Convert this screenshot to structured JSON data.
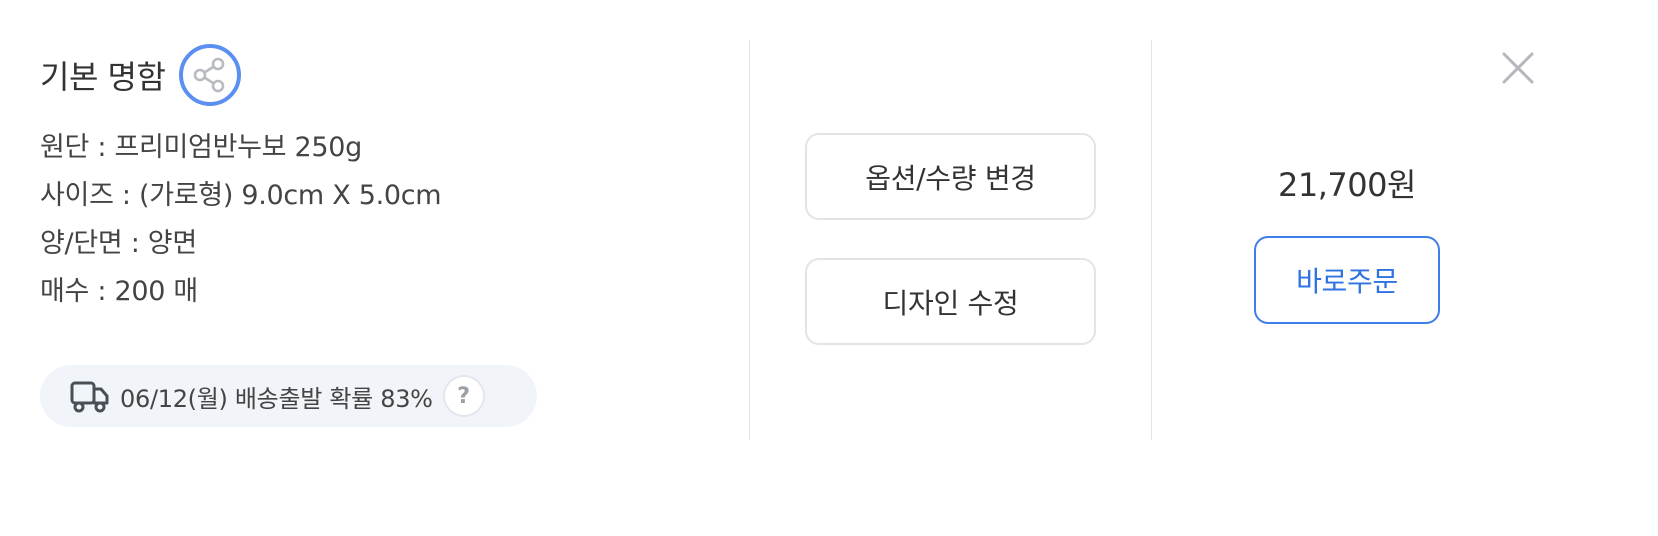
{
  "product": {
    "title": "기본 명함",
    "specs": [
      "원단 : 프리미엄반누보 250g",
      "사이즈 : (가로형) 9.0cm X 5.0cm",
      "양/단면 : 양면",
      "매수 : 200 매"
    ]
  },
  "delivery": {
    "text": "06/12(월) 배송출발 확률 83%",
    "help_label": "?"
  },
  "actions": {
    "change_options_label": "옵션/수량 변경",
    "edit_design_label": "디자인 수정"
  },
  "order": {
    "price": "21,700원",
    "order_now_label": "바로주문"
  },
  "colors": {
    "accent": "#3f7de8",
    "share_ring": "#5b8ff0",
    "delivery_bg": "#f1f4f8"
  },
  "icons": {
    "share": "share-icon",
    "truck": "truck-icon",
    "help": "help-icon",
    "close": "close-icon"
  }
}
